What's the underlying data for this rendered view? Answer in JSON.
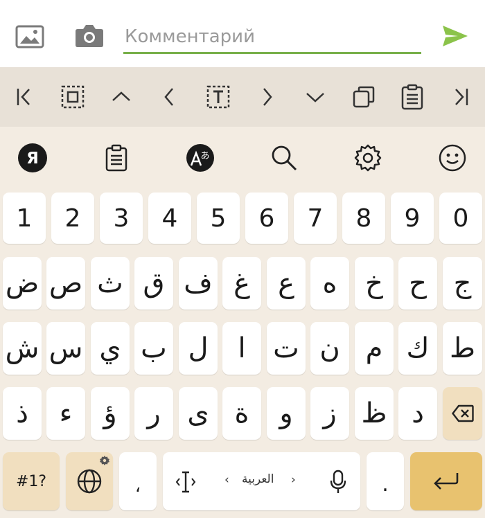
{
  "comment": {
    "placeholder": "Комментарий",
    "value": ""
  },
  "toolbar": {
    "icons": [
      "cursor-start-icon",
      "select-all-icon",
      "arrow-up-icon",
      "arrow-left-icon",
      "text-select-icon",
      "arrow-right-icon",
      "arrow-down-icon",
      "copy-icon",
      "paste-icon",
      "cursor-end-icon"
    ]
  },
  "suggestions": {
    "logo_letter": "Я",
    "icons": [
      "yandex-logo-icon",
      "clipboard-icon",
      "translate-icon",
      "search-icon",
      "settings-icon",
      "emoji-icon"
    ]
  },
  "keyboard": {
    "number_row": [
      "1",
      "2",
      "3",
      "4",
      "5",
      "6",
      "7",
      "8",
      "9",
      "0"
    ],
    "row1": [
      "ض",
      "ص",
      "ث",
      "ق",
      "ف",
      "غ",
      "ع",
      "ه",
      "خ",
      "ح",
      "ج"
    ],
    "row2": [
      "ش",
      "س",
      "ي",
      "ب",
      "ل",
      "ا",
      "ت",
      "ن",
      "م",
      "ك",
      "ط"
    ],
    "row3": [
      "ذ",
      "ء",
      "ؤ",
      "ر",
      "ى",
      "ة",
      "و",
      "ز",
      "ظ",
      "د"
    ],
    "symbols_label": "#1?",
    "comma": "،",
    "space_label": "العربية",
    "space_left_arrow": "‹",
    "space_right_arrow": "›",
    "period": "."
  },
  "colors": {
    "accent_green": "#78b04a",
    "send_green": "#8bc34a",
    "enter_key": "#e8c26f",
    "function_key": "#f1dfbf"
  }
}
